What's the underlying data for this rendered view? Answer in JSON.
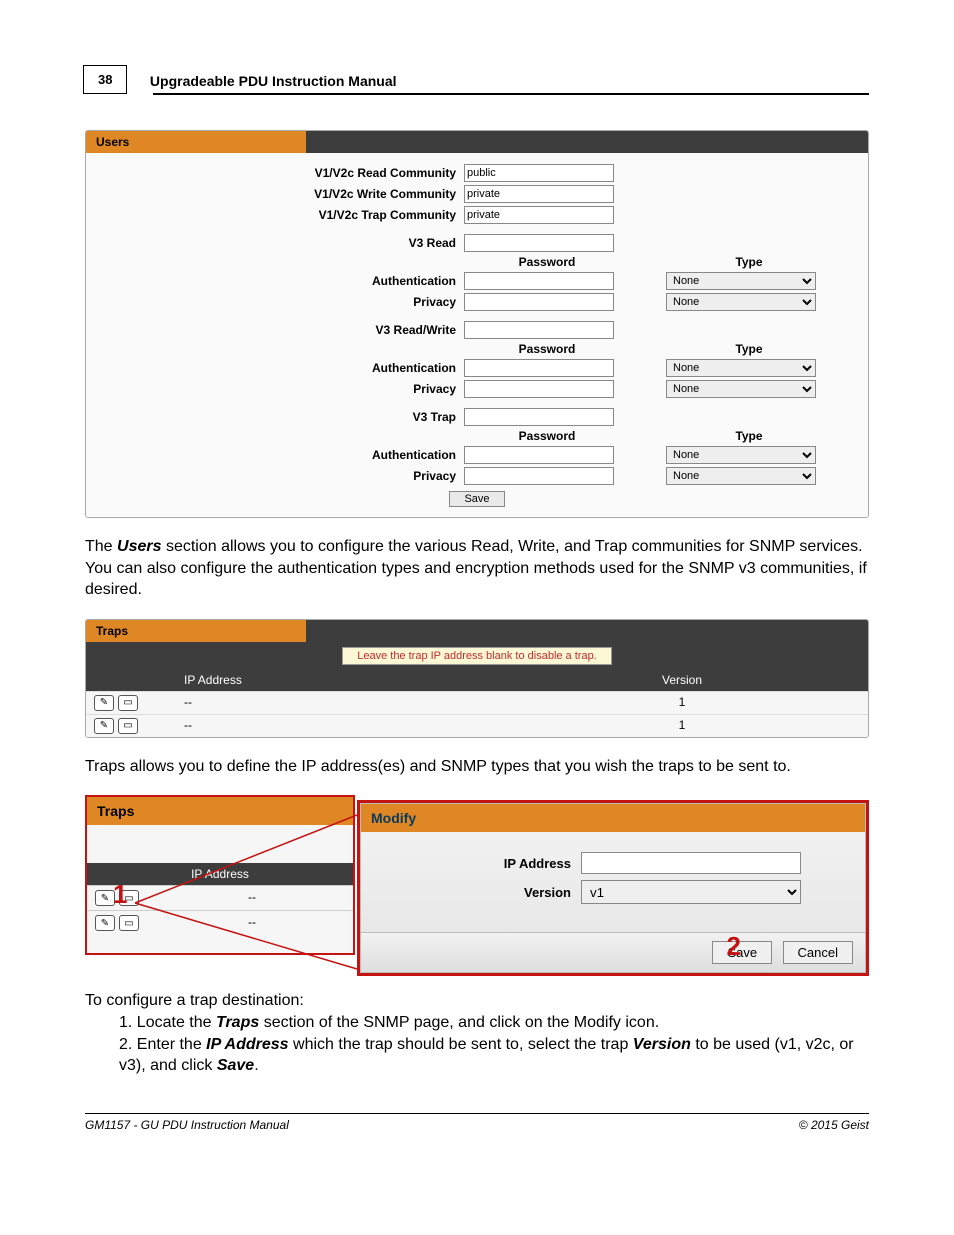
{
  "page": {
    "number": "38",
    "manual_title": "Upgradeable PDU Instruction Manual",
    "footer_left": "GM1157 - GU PDU Instruction Manual",
    "footer_right": "© 2015 Geist"
  },
  "snmp": {
    "title": "Users",
    "rows": {
      "read_comm": {
        "label": "V1/V2c Read Community",
        "value": "public"
      },
      "write_comm": {
        "label": "V1/V2c Write Community",
        "value": "private"
      },
      "trap_comm": {
        "label": "V1/V2c Trap Community",
        "value": "private"
      },
      "v3read_label": "V3 Read",
      "v3rw_label": "V3 Read/Write",
      "v3trap_label": "V3 Trap",
      "auth_label": "Authentication",
      "priv_label": "Privacy",
      "pw_hdr": "Password",
      "type_hdr": "Type",
      "type_opt": "None"
    },
    "save_label": "Save"
  },
  "para1_pre": "The ",
  "para1_bi": "Users",
  "para1_post": " section allows you to configure the various Read, Write, and Trap communities for SNMP services.  You can also configure the authentication types and encryption methods used for the SNMP v3 communities, if desired.",
  "traps": {
    "title": "Traps",
    "hint": "Leave the trap IP address blank to disable a trap.",
    "col_ip": "IP Address",
    "col_ver": "Version",
    "rows": [
      {
        "ip": "--",
        "ver": "1"
      },
      {
        "ip": "--",
        "ver": "1"
      }
    ]
  },
  "para2": "Traps allows you to define the IP address(es) and SNMP types that you wish the traps to be sent to.",
  "modify": {
    "back_title": "Traps",
    "back_col_ip": "IP Address",
    "red1": "1",
    "red2": "2",
    "title": "Modify",
    "ip_label": "IP Address",
    "ver_label": "Version",
    "ver_value": "v1",
    "save": "Save",
    "cancel": "Cancel"
  },
  "instr": {
    "lead": "To configure a trap destination:",
    "s1_a": "Locate the ",
    "s1_b": "Traps",
    "s1_c": " section of the SNMP page, and click on the Modify icon.",
    "s2_a": "Enter the ",
    "s2_b": "IP Address",
    "s2_c": " which the trap should be sent to, select the trap ",
    "s2_d": "Version",
    "s2_e": " to be used (v1, v2c, or v3), and click ",
    "s2_f": "Save",
    "s2_g": "."
  }
}
